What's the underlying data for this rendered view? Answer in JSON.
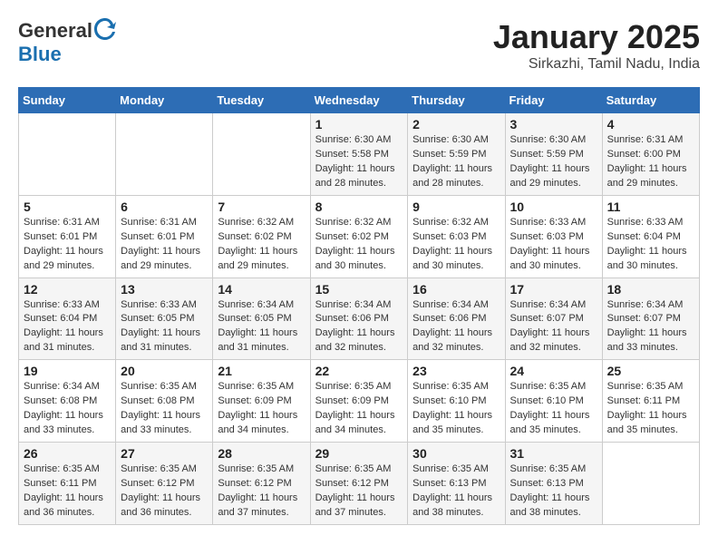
{
  "header": {
    "logo_line1": "General",
    "logo_line2": "Blue",
    "month": "January 2025",
    "location": "Sirkazhi, Tamil Nadu, India"
  },
  "calendar": {
    "weekdays": [
      "Sunday",
      "Monday",
      "Tuesday",
      "Wednesday",
      "Thursday",
      "Friday",
      "Saturday"
    ],
    "rows": [
      [
        {
          "day": "",
          "sunrise": "",
          "sunset": "",
          "daylight": ""
        },
        {
          "day": "",
          "sunrise": "",
          "sunset": "",
          "daylight": ""
        },
        {
          "day": "",
          "sunrise": "",
          "sunset": "",
          "daylight": ""
        },
        {
          "day": "1",
          "sunrise": "Sunrise: 6:30 AM",
          "sunset": "Sunset: 5:58 PM",
          "daylight": "Daylight: 11 hours and 28 minutes."
        },
        {
          "day": "2",
          "sunrise": "Sunrise: 6:30 AM",
          "sunset": "Sunset: 5:59 PM",
          "daylight": "Daylight: 11 hours and 28 minutes."
        },
        {
          "day": "3",
          "sunrise": "Sunrise: 6:30 AM",
          "sunset": "Sunset: 5:59 PM",
          "daylight": "Daylight: 11 hours and 29 minutes."
        },
        {
          "day": "4",
          "sunrise": "Sunrise: 6:31 AM",
          "sunset": "Sunset: 6:00 PM",
          "daylight": "Daylight: 11 hours and 29 minutes."
        }
      ],
      [
        {
          "day": "5",
          "sunrise": "Sunrise: 6:31 AM",
          "sunset": "Sunset: 6:01 PM",
          "daylight": "Daylight: 11 hours and 29 minutes."
        },
        {
          "day": "6",
          "sunrise": "Sunrise: 6:31 AM",
          "sunset": "Sunset: 6:01 PM",
          "daylight": "Daylight: 11 hours and 29 minutes."
        },
        {
          "day": "7",
          "sunrise": "Sunrise: 6:32 AM",
          "sunset": "Sunset: 6:02 PM",
          "daylight": "Daylight: 11 hours and 29 minutes."
        },
        {
          "day": "8",
          "sunrise": "Sunrise: 6:32 AM",
          "sunset": "Sunset: 6:02 PM",
          "daylight": "Daylight: 11 hours and 30 minutes."
        },
        {
          "day": "9",
          "sunrise": "Sunrise: 6:32 AM",
          "sunset": "Sunset: 6:03 PM",
          "daylight": "Daylight: 11 hours and 30 minutes."
        },
        {
          "day": "10",
          "sunrise": "Sunrise: 6:33 AM",
          "sunset": "Sunset: 6:03 PM",
          "daylight": "Daylight: 11 hours and 30 minutes."
        },
        {
          "day": "11",
          "sunrise": "Sunrise: 6:33 AM",
          "sunset": "Sunset: 6:04 PM",
          "daylight": "Daylight: 11 hours and 30 minutes."
        }
      ],
      [
        {
          "day": "12",
          "sunrise": "Sunrise: 6:33 AM",
          "sunset": "Sunset: 6:04 PM",
          "daylight": "Daylight: 11 hours and 31 minutes."
        },
        {
          "day": "13",
          "sunrise": "Sunrise: 6:33 AM",
          "sunset": "Sunset: 6:05 PM",
          "daylight": "Daylight: 11 hours and 31 minutes."
        },
        {
          "day": "14",
          "sunrise": "Sunrise: 6:34 AM",
          "sunset": "Sunset: 6:05 PM",
          "daylight": "Daylight: 11 hours and 31 minutes."
        },
        {
          "day": "15",
          "sunrise": "Sunrise: 6:34 AM",
          "sunset": "Sunset: 6:06 PM",
          "daylight": "Daylight: 11 hours and 32 minutes."
        },
        {
          "day": "16",
          "sunrise": "Sunrise: 6:34 AM",
          "sunset": "Sunset: 6:06 PM",
          "daylight": "Daylight: 11 hours and 32 minutes."
        },
        {
          "day": "17",
          "sunrise": "Sunrise: 6:34 AM",
          "sunset": "Sunset: 6:07 PM",
          "daylight": "Daylight: 11 hours and 32 minutes."
        },
        {
          "day": "18",
          "sunrise": "Sunrise: 6:34 AM",
          "sunset": "Sunset: 6:07 PM",
          "daylight": "Daylight: 11 hours and 33 minutes."
        }
      ],
      [
        {
          "day": "19",
          "sunrise": "Sunrise: 6:34 AM",
          "sunset": "Sunset: 6:08 PM",
          "daylight": "Daylight: 11 hours and 33 minutes."
        },
        {
          "day": "20",
          "sunrise": "Sunrise: 6:35 AM",
          "sunset": "Sunset: 6:08 PM",
          "daylight": "Daylight: 11 hours and 33 minutes."
        },
        {
          "day": "21",
          "sunrise": "Sunrise: 6:35 AM",
          "sunset": "Sunset: 6:09 PM",
          "daylight": "Daylight: 11 hours and 34 minutes."
        },
        {
          "day": "22",
          "sunrise": "Sunrise: 6:35 AM",
          "sunset": "Sunset: 6:09 PM",
          "daylight": "Daylight: 11 hours and 34 minutes."
        },
        {
          "day": "23",
          "sunrise": "Sunrise: 6:35 AM",
          "sunset": "Sunset: 6:10 PM",
          "daylight": "Daylight: 11 hours and 35 minutes."
        },
        {
          "day": "24",
          "sunrise": "Sunrise: 6:35 AM",
          "sunset": "Sunset: 6:10 PM",
          "daylight": "Daylight: 11 hours and 35 minutes."
        },
        {
          "day": "25",
          "sunrise": "Sunrise: 6:35 AM",
          "sunset": "Sunset: 6:11 PM",
          "daylight": "Daylight: 11 hours and 35 minutes."
        }
      ],
      [
        {
          "day": "26",
          "sunrise": "Sunrise: 6:35 AM",
          "sunset": "Sunset: 6:11 PM",
          "daylight": "Daylight: 11 hours and 36 minutes."
        },
        {
          "day": "27",
          "sunrise": "Sunrise: 6:35 AM",
          "sunset": "Sunset: 6:12 PM",
          "daylight": "Daylight: 11 hours and 36 minutes."
        },
        {
          "day": "28",
          "sunrise": "Sunrise: 6:35 AM",
          "sunset": "Sunset: 6:12 PM",
          "daylight": "Daylight: 11 hours and 37 minutes."
        },
        {
          "day": "29",
          "sunrise": "Sunrise: 6:35 AM",
          "sunset": "Sunset: 6:12 PM",
          "daylight": "Daylight: 11 hours and 37 minutes."
        },
        {
          "day": "30",
          "sunrise": "Sunrise: 6:35 AM",
          "sunset": "Sunset: 6:13 PM",
          "daylight": "Daylight: 11 hours and 38 minutes."
        },
        {
          "day": "31",
          "sunrise": "Sunrise: 6:35 AM",
          "sunset": "Sunset: 6:13 PM",
          "daylight": "Daylight: 11 hours and 38 minutes."
        },
        {
          "day": "",
          "sunrise": "",
          "sunset": "",
          "daylight": ""
        }
      ]
    ]
  }
}
